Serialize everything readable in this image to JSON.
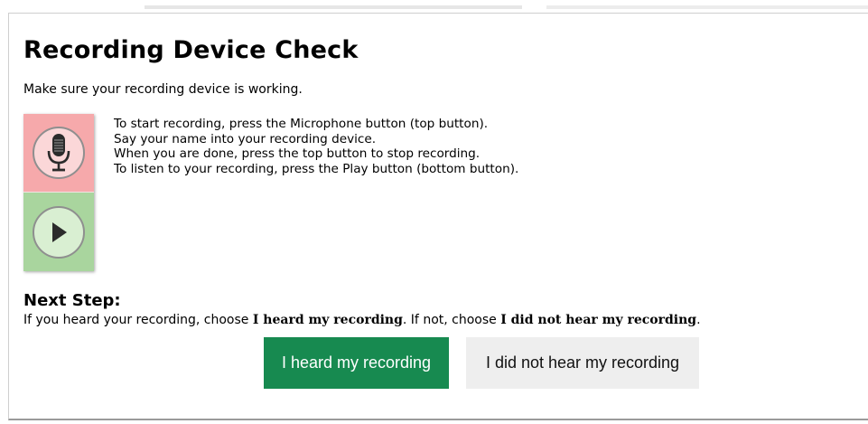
{
  "page": {
    "title": "Recording Device Check",
    "subtitle": "Make sure your recording device is working."
  },
  "device": {
    "record_icon": "microphone-icon",
    "play_icon": "play-icon",
    "record_color": "#f6a9ab",
    "play_color": "#a9d59e"
  },
  "instructions": [
    "To start recording, press the Microphone button (top button).",
    "Say your name into your recording device.",
    "When you are done, press the top button to stop recording.",
    "To listen to your recording, press the Play button (bottom button)."
  ],
  "next_step": {
    "heading": "Next Step:",
    "text_prefix": "If you heard your recording, choose ",
    "heard_bold": "I heard my recording",
    "text_middle": ". If not, choose ",
    "not_heard_bold": "I did not hear my recording",
    "text_suffix": "."
  },
  "buttons": {
    "heard": "I heard my recording",
    "not_heard": "I did not hear my recording",
    "heard_color": "#178a50",
    "not_heard_color": "#eeeeee"
  }
}
